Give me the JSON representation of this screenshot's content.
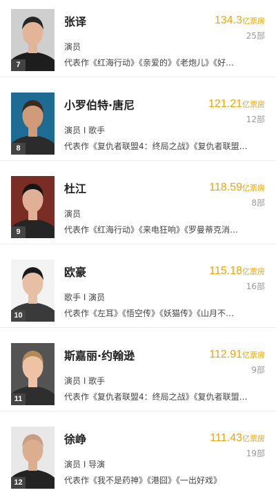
{
  "stars": [
    {
      "rank": "7",
      "name": "张译",
      "box_office": "134.3",
      "box_unit": "亿票房",
      "film_count": "25部",
      "roles": "演员",
      "works": "代表作《红海行动》《亲爱的》《老炮儿》《好…",
      "colors": {
        "bg": "#cfcfcf",
        "skin": "#e2b598",
        "hair": "#262626",
        "cloth": "#1d1d1d"
      }
    },
    {
      "rank": "8",
      "name": "小罗伯特·唐尼",
      "box_office": "121.21",
      "box_unit": "亿票房",
      "film_count": "12部",
      "roles": "演员 I 歌手",
      "works": "代表作《复仇者联盟4：终局之战》《复仇者联盟…",
      "colors": {
        "bg": "#1e6b93",
        "skin": "#d19a78",
        "hair": "#3a2a20",
        "cloth": "#2b2b2b"
      }
    },
    {
      "rank": "9",
      "name": "杜江",
      "box_office": "118.59",
      "box_unit": "亿票房",
      "film_count": "8部",
      "roles": "演员",
      "works": "代表作《红海行动》《来电狂响》《罗曼蒂克消…",
      "colors": {
        "bg": "#7a2d25",
        "skin": "#e0b096",
        "hair": "#161616",
        "cloth": "#252525"
      }
    },
    {
      "rank": "10",
      "name": "欧豪",
      "box_office": "115.18",
      "box_unit": "亿票房",
      "film_count": "16部",
      "roles": "歌手 I 演员",
      "works": "代表作《左耳》《悟空传》《妖猫传》《山月不…",
      "colors": {
        "bg": "#f3f3f3",
        "skin": "#e6bfa5",
        "hair": "#1a1a1a",
        "cloth": "#3a3a3a"
      }
    },
    {
      "rank": "11",
      "name": "斯嘉丽·约翰逊",
      "box_office": "112.91",
      "box_unit": "亿票房",
      "film_count": "9部",
      "roles": "演员 I 歌手",
      "works": "代表作《复仇者联盟4：终局之战》《复仇者联盟…",
      "colors": {
        "bg": "#545454",
        "skin": "#eec2a4",
        "hair": "#b38a55",
        "cloth": "#2e2e2e"
      }
    },
    {
      "rank": "12",
      "name": "徐峥",
      "box_office": "111.43",
      "box_unit": "亿票房",
      "film_count": "19部",
      "roles": "演员 I 导演",
      "works": "代表作《我不是药神》《港囧》《一出好戏》",
      "colors": {
        "bg": "#e8e8e8",
        "skin": "#dcae90",
        "hair": "#c89d84",
        "cloth": "#232323"
      }
    }
  ]
}
